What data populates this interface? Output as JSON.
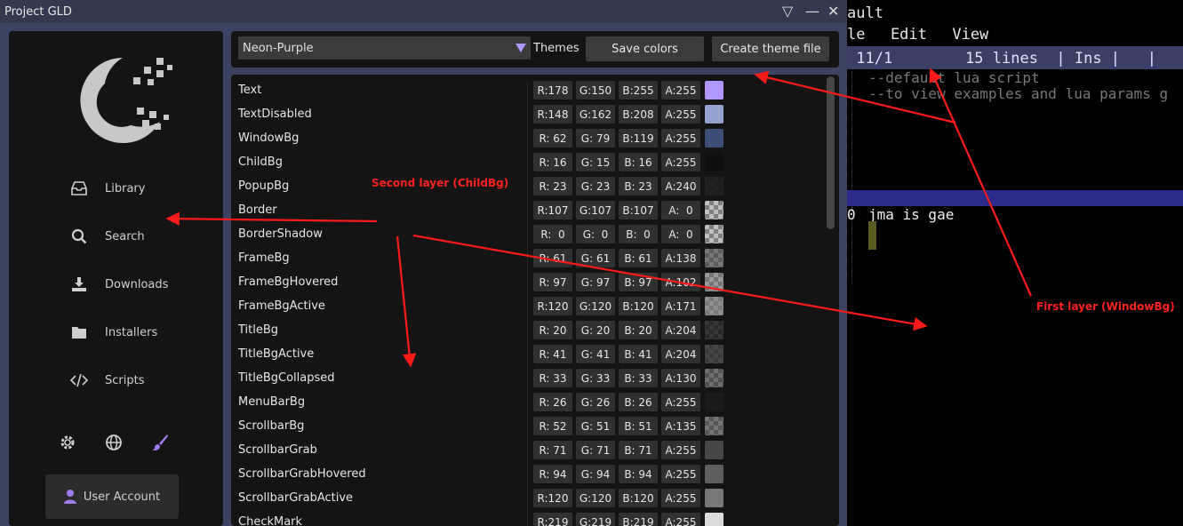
{
  "window": {
    "title": "Project GLD",
    "btn_dropdown": "▽",
    "btn_minimize": "—",
    "btn_close": "✕"
  },
  "sidebar": {
    "items": [
      {
        "label": "Library",
        "icon": "inbox-icon"
      },
      {
        "label": "Search",
        "icon": "search-icon"
      },
      {
        "label": "Downloads",
        "icon": "download-icon"
      },
      {
        "label": "Installers",
        "icon": "folder-icon"
      },
      {
        "label": "Scripts",
        "icon": "code-icon"
      }
    ],
    "bottom_icons": [
      "gear-icon",
      "globe-icon",
      "brush-icon"
    ],
    "user_button": "User Account",
    "accent": "#a07cf0"
  },
  "toolbar": {
    "theme_value": "Neon-Purple",
    "themes_label": "Themes",
    "save_label": "Save colors",
    "create_label": "Create theme file"
  },
  "colors": [
    {
      "name": "Text",
      "r": "R:178",
      "g": "G:150",
      "b": "B:255",
      "a": "A:255",
      "rgb": [
        178,
        150,
        255
      ],
      "alpha": 255
    },
    {
      "name": "TextDisabled",
      "r": "R:148",
      "g": "G:162",
      "b": "B:208",
      "a": "A:255",
      "rgb": [
        148,
        162,
        208
      ],
      "alpha": 255
    },
    {
      "name": "WindowBg",
      "r": "R: 62",
      "g": "G: 79",
      "b": "B:119",
      "a": "A:255",
      "rgb": [
        62,
        79,
        119
      ],
      "alpha": 255
    },
    {
      "name": "ChildBg",
      "r": "R: 16",
      "g": "G: 15",
      "b": "B: 16",
      "a": "A:255",
      "rgb": [
        16,
        15,
        16
      ],
      "alpha": 255
    },
    {
      "name": "PopupBg",
      "r": "R: 23",
      "g": "G: 23",
      "b": "B: 23",
      "a": "A:240",
      "rgb": [
        23,
        23,
        23
      ],
      "alpha": 240
    },
    {
      "name": "Border",
      "r": "R:107",
      "g": "G:107",
      "b": "B:107",
      "a": "A:  0",
      "rgb": [
        107,
        107,
        107
      ],
      "alpha": 0
    },
    {
      "name": "BorderShadow",
      "r": "R:  0",
      "g": "G:  0",
      "b": "B:  0",
      "a": "A:  0",
      "rgb": [
        0,
        0,
        0
      ],
      "alpha": 0
    },
    {
      "name": "FrameBg",
      "r": "R: 61",
      "g": "G: 61",
      "b": "B: 61",
      "a": "A:138",
      "rgb": [
        61,
        61,
        61
      ],
      "alpha": 138
    },
    {
      "name": "FrameBgHovered",
      "r": "R: 97",
      "g": "G: 97",
      "b": "B: 97",
      "a": "A:102",
      "rgb": [
        97,
        97,
        97
      ],
      "alpha": 102
    },
    {
      "name": "FrameBgActive",
      "r": "R:120",
      "g": "G:120",
      "b": "B:120",
      "a": "A:171",
      "rgb": [
        120,
        120,
        120
      ],
      "alpha": 171
    },
    {
      "name": "TitleBg",
      "r": "R: 20",
      "g": "G: 20",
      "b": "B: 20",
      "a": "A:204",
      "rgb": [
        20,
        20,
        20
      ],
      "alpha": 204
    },
    {
      "name": "TitleBgActive",
      "r": "R: 41",
      "g": "G: 41",
      "b": "B: 41",
      "a": "A:204",
      "rgb": [
        41,
        41,
        41
      ],
      "alpha": 204
    },
    {
      "name": "TitleBgCollapsed",
      "r": "R: 33",
      "g": "G: 33",
      "b": "B: 33",
      "a": "A:130",
      "rgb": [
        33,
        33,
        33
      ],
      "alpha": 130
    },
    {
      "name": "MenuBarBg",
      "r": "R: 26",
      "g": "G: 26",
      "b": "B: 26",
      "a": "A:255",
      "rgb": [
        26,
        26,
        26
      ],
      "alpha": 255
    },
    {
      "name": "ScrollbarBg",
      "r": "R: 52",
      "g": "G: 51",
      "b": "B: 51",
      "a": "A:135",
      "rgb": [
        52,
        51,
        51
      ],
      "alpha": 135
    },
    {
      "name": "ScrollbarGrab",
      "r": "R: 71",
      "g": "G: 71",
      "b": "B: 71",
      "a": "A:255",
      "rgb": [
        71,
        71,
        71
      ],
      "alpha": 255
    },
    {
      "name": "ScrollbarGrabHovered",
      "r": "R: 94",
      "g": "G: 94",
      "b": "B: 94",
      "a": "A:255",
      "rgb": [
        94,
        94,
        94
      ],
      "alpha": 255
    },
    {
      "name": "ScrollbarGrabActive",
      "r": "R:120",
      "g": "G:120",
      "b": "B:120",
      "a": "A:255",
      "rgb": [
        120,
        120,
        120
      ],
      "alpha": 255
    },
    {
      "name": "CheckMark",
      "r": "R:219",
      "g": "G:219",
      "b": "B:219",
      "a": "A:255",
      "rgb": [
        219,
        219,
        219
      ],
      "alpha": 255
    }
  ],
  "editor": {
    "title": "ault",
    "menu": "le  Edit  View",
    "status": " 11/1        15 lines  | Ins |   |",
    "code_line1": "--default lua script",
    "code_line2": "--to view examples and lua params g",
    "gutter_marker": "0",
    "current_line": "jma is gae"
  },
  "annotations": {
    "second_layer": "Second layer (ChildBg)",
    "first_layer": "First layer (WindowBg)",
    "color": "#ff1a1a"
  }
}
